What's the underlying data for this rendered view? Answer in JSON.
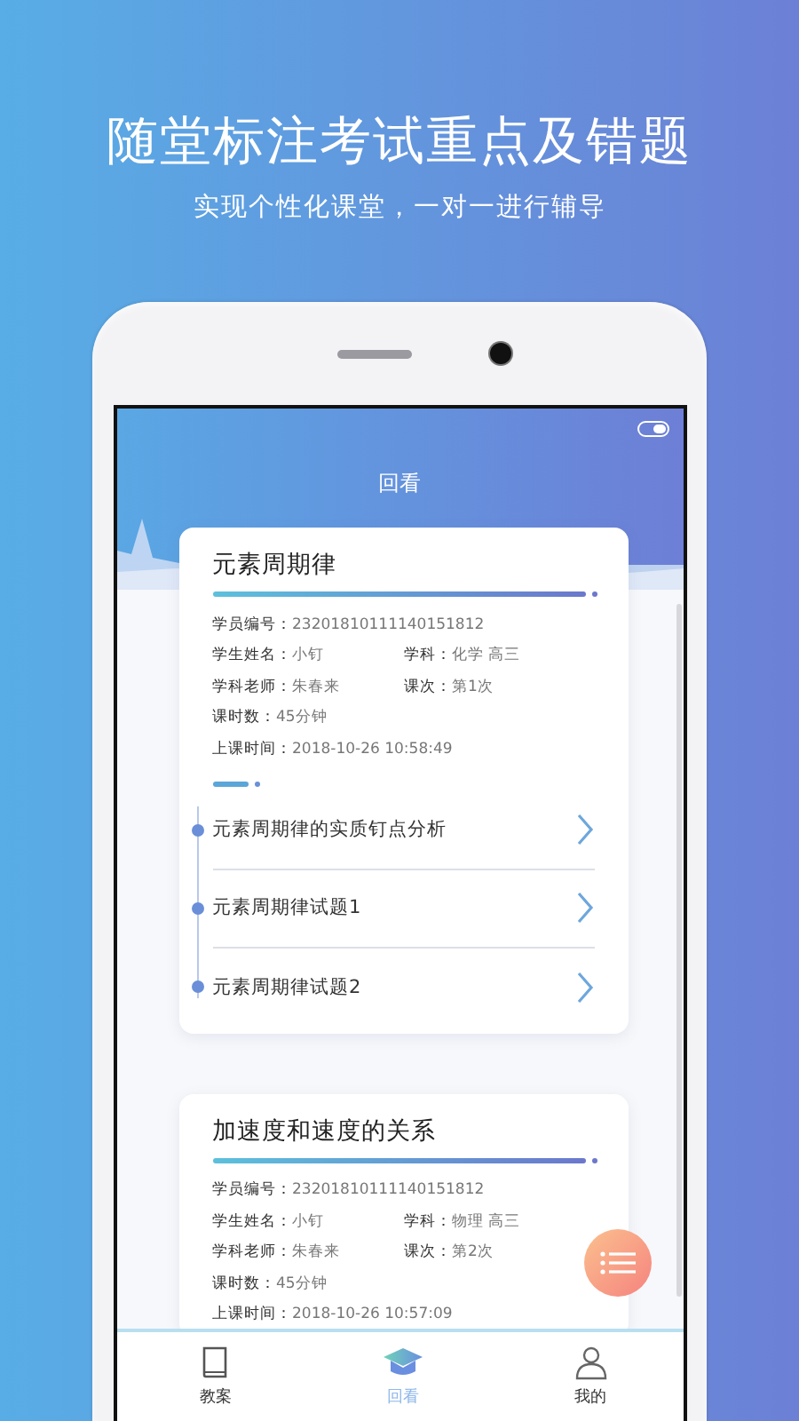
{
  "headline": "随堂标注考试重点及错题",
  "subtitle": "实现个性化课堂，一对一进行辅导",
  "app": {
    "title": "回看",
    "courses": [
      {
        "title": "元素周期律",
        "rows": [
          [
            {
              "label": "学员编号：",
              "value": "23201810111140151812"
            }
          ],
          [
            {
              "label": "学生姓名：",
              "value": "小钉"
            },
            {
              "label": "学科：",
              "value": "化学 高三"
            }
          ],
          [
            {
              "label": "学科老师：",
              "value": "朱春来"
            },
            {
              "label": "课次：",
              "value": "第1次"
            }
          ],
          [
            {
              "label": "课时数：",
              "value": "45分钟"
            }
          ],
          [
            {
              "label": "上课时间：",
              "value": "2018-10-26 10:58:49"
            }
          ]
        ],
        "items": [
          "元素周期律的实质钉点分析",
          "元素周期律试题1",
          "元素周期律试题2"
        ]
      },
      {
        "title": "加速度和速度的关系",
        "rows": [
          [
            {
              "label": "学员编号：",
              "value": "23201810111140151812"
            }
          ],
          [
            {
              "label": "学生姓名：",
              "value": "小钉"
            },
            {
              "label": "学科：",
              "value": "物理 高三"
            }
          ],
          [
            {
              "label": "学科老师：",
              "value": "朱春来"
            },
            {
              "label": "课次：",
              "value": "第2次"
            }
          ],
          [
            {
              "label": "课时数：",
              "value": "45分钟"
            }
          ],
          [
            {
              "label": "上课时间：",
              "value": "2018-10-26 10:57:09"
            }
          ]
        ]
      }
    ],
    "tabs": [
      {
        "label": "教案",
        "selected": false
      },
      {
        "label": "回看",
        "selected": true
      },
      {
        "label": "我的",
        "selected": false
      }
    ]
  }
}
